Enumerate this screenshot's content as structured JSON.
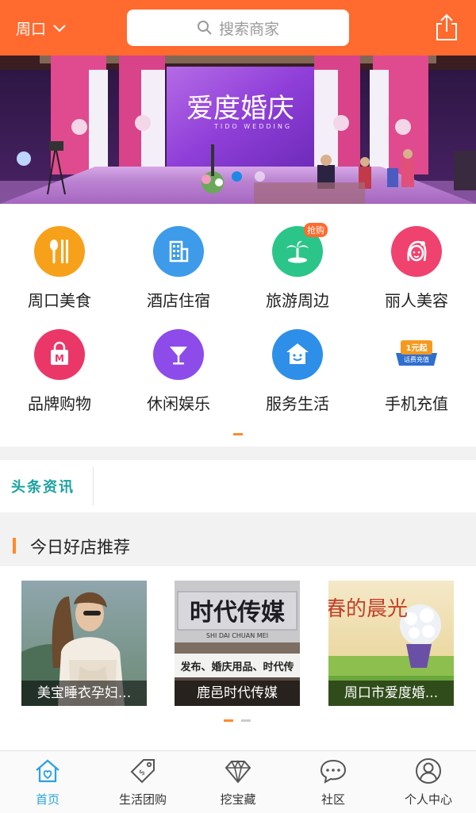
{
  "header": {
    "city": "周口",
    "search_placeholder": "搜索商家"
  },
  "banner": {
    "title": "爱度婚庆",
    "subtitle": "TIDO WEDDING",
    "slide_count": 2,
    "active_slide": 1
  },
  "categories": [
    {
      "label": "周口美食",
      "icon": "fork-knife-icon",
      "color": "#f7a11a"
    },
    {
      "label": "酒店住宿",
      "icon": "hotel-building-icon",
      "color": "#3d9be9"
    },
    {
      "label": "旅游周边",
      "icon": "palm-island-icon",
      "color": "#2bc58a",
      "tag": "抢购"
    },
    {
      "label": "丽人美容",
      "icon": "woman-face-icon",
      "color": "#f0426e"
    },
    {
      "label": "品牌购物",
      "icon": "shopping-bag-icon",
      "color": "#ea3768"
    },
    {
      "label": "休闲娱乐",
      "icon": "cocktail-icon",
      "color": "#8d4bea"
    },
    {
      "label": "服务生活",
      "icon": "smile-house-icon",
      "color": "#2e8fe8"
    },
    {
      "label": "手机充值",
      "icon": "recharge-badge-icon",
      "color": "#f59a1e",
      "badge_text": "1元起",
      "badge_sub": "话费充值"
    }
  ],
  "headline": {
    "label": "头条资讯"
  },
  "recommend": {
    "title": "今日好店推荐",
    "shops": [
      {
        "name": "美宝睡衣孕妇..."
      },
      {
        "name": "鹿邑时代传媒",
        "sign_main": "时代传媒",
        "sign_pinyin": "SHI DAI CHUAN MEI",
        "sign_sub": "发布、婚庆用品、时代传"
      },
      {
        "name": "周口市爱度婚...",
        "overlay_text": "春的晨光"
      }
    ]
  },
  "tabbar": [
    {
      "label": "首页",
      "icon": "home-icon",
      "active": true
    },
    {
      "label": "生活团购",
      "icon": "price-tag-icon",
      "active": false
    },
    {
      "label": "挖宝藏",
      "icon": "diamond-icon",
      "active": false
    },
    {
      "label": "社区",
      "icon": "chat-bubble-icon",
      "active": false
    },
    {
      "label": "个人中心",
      "icon": "user-icon",
      "active": false
    }
  ],
  "colors": {
    "header_bg": "#ff6a2e",
    "accent_orange": "#ff8a2a",
    "headline_teal": "#1aa3a0",
    "tab_active": "#29a3e0"
  }
}
